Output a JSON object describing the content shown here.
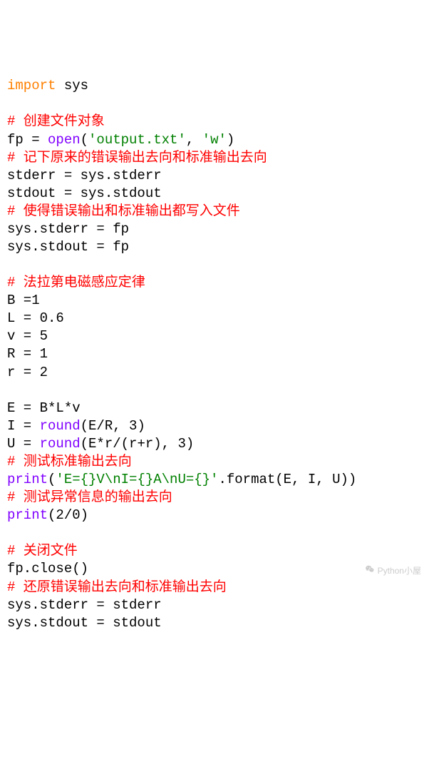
{
  "code": {
    "l1_import": "import",
    "l1_sys": " sys",
    "l3_comment": "# 创建文件对象",
    "l4_a": "fp = ",
    "l4_open": "open",
    "l4_b": "(",
    "l4_s1": "'output.txt'",
    "l4_c": ", ",
    "l4_s2": "'w'",
    "l4_d": ")",
    "l5_comment": "# 记下原来的错误输出去向和标准输出去向",
    "l6": "stderr = sys.stderr",
    "l7": "stdout = sys.stdout",
    "l8_comment": "# 使得错误输出和标准输出都写入文件",
    "l9": "sys.stderr = fp",
    "l10": "sys.stdout = fp",
    "l12_comment": "# 法拉第电磁感应定律",
    "l13": "B =1",
    "l14": "L = 0.6",
    "l15": "v = 5",
    "l16": "R = 1",
    "l17": "r = 2",
    "l19": "E = B*L*v",
    "l20_a": "I = ",
    "l20_round": "round",
    "l20_b": "(E/R, 3)",
    "l21_a": "U = ",
    "l21_round": "round",
    "l21_b": "(E*r/(r+r), 3)",
    "l22_comment": "# 测试标准输出去向",
    "l23_print": "print",
    "l23_a": "(",
    "l23_s": "'E={}V\\nI={}A\\nU={}'",
    "l23_b": ".format(E, I, U))",
    "l24_comment": "# 测试异常信息的输出去向",
    "l25_print": "print",
    "l25_a": "(2/0)",
    "l27_comment": "# 关闭文件",
    "l28": "fp.close()",
    "l29_comment": "# 还原错误输出去向和标准输出去向",
    "l30": "sys.stderr = stderr",
    "l31": "sys.stdout = stdout"
  },
  "watermark": {
    "text": "Python小屋"
  }
}
